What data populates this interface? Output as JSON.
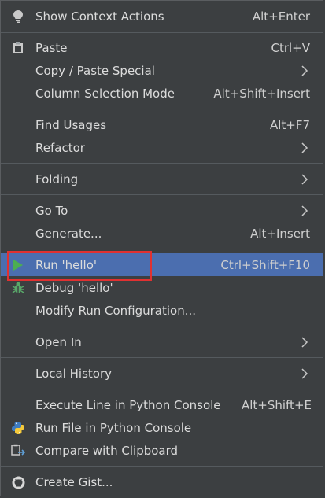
{
  "menu": {
    "items": [
      {
        "label": "Show Context Actions",
        "shortcut": "Alt+Enter"
      },
      {
        "label": "Paste",
        "shortcut": "Ctrl+V"
      },
      {
        "label": "Copy / Paste Special"
      },
      {
        "label": "Column Selection Mode",
        "shortcut": "Alt+Shift+Insert"
      },
      {
        "label": "Find Usages",
        "shortcut": "Alt+F7"
      },
      {
        "label": "Refactor"
      },
      {
        "label": "Folding"
      },
      {
        "label": "Go To"
      },
      {
        "label": "Generate...",
        "shortcut": "Alt+Insert"
      },
      {
        "label": "Run 'hello'",
        "shortcut": "Ctrl+Shift+F10"
      },
      {
        "label": "Debug 'hello'"
      },
      {
        "label": "Modify Run Configuration..."
      },
      {
        "label": "Open In"
      },
      {
        "label": "Local History"
      },
      {
        "label": "Execute Line in Python Console",
        "shortcut": "Alt+Shift+E"
      },
      {
        "label": "Run File in Python Console"
      },
      {
        "label": "Compare with Clipboard"
      },
      {
        "label": "Create Gist..."
      }
    ]
  },
  "icons": {
    "bulb": "bulb-icon",
    "paste": "clipboard-icon",
    "run": "run-icon",
    "debug": "debug-icon",
    "python": "python-icon",
    "compare": "compare-icon",
    "github": "github-icon"
  },
  "colors": {
    "background": "#3c3f41",
    "selected": "#4b6eaf",
    "highlight_box": "#e03131",
    "run_green": "#4caf50"
  }
}
